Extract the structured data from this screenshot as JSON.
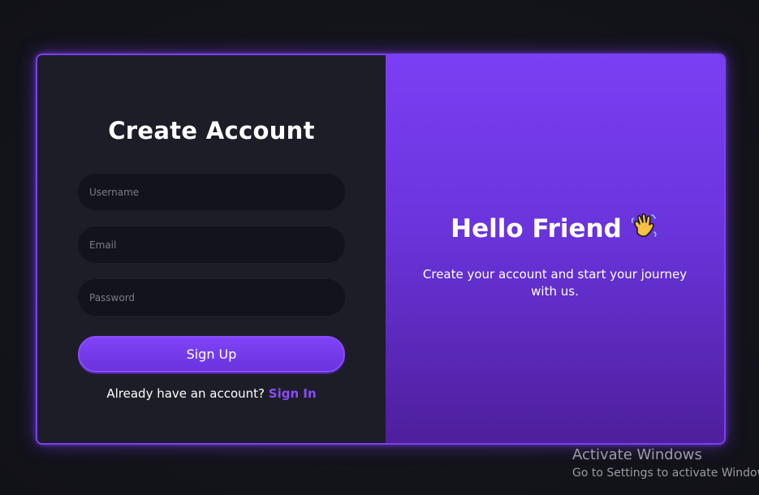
{
  "form": {
    "title": "Create Account",
    "username_placeholder": "Username",
    "email_placeholder": "Email",
    "password_placeholder": "Password",
    "signup_label": "Sign Up",
    "signin_prompt": "Already have an account?",
    "signin_link": "Sign In"
  },
  "welcome": {
    "title": "Hello Friend",
    "icon": "waving-hand-icon",
    "subtext": "Create your account and start your journey with us."
  },
  "watermark": {
    "title": "Activate Windows",
    "subtitle": "Go to Settings to activate Windows."
  },
  "colors": {
    "accent": "#7b3ff2",
    "link": "#8a4cf8",
    "panel_dark": "#1d1d28",
    "input_bg": "#13131b",
    "background": "#14141c"
  }
}
